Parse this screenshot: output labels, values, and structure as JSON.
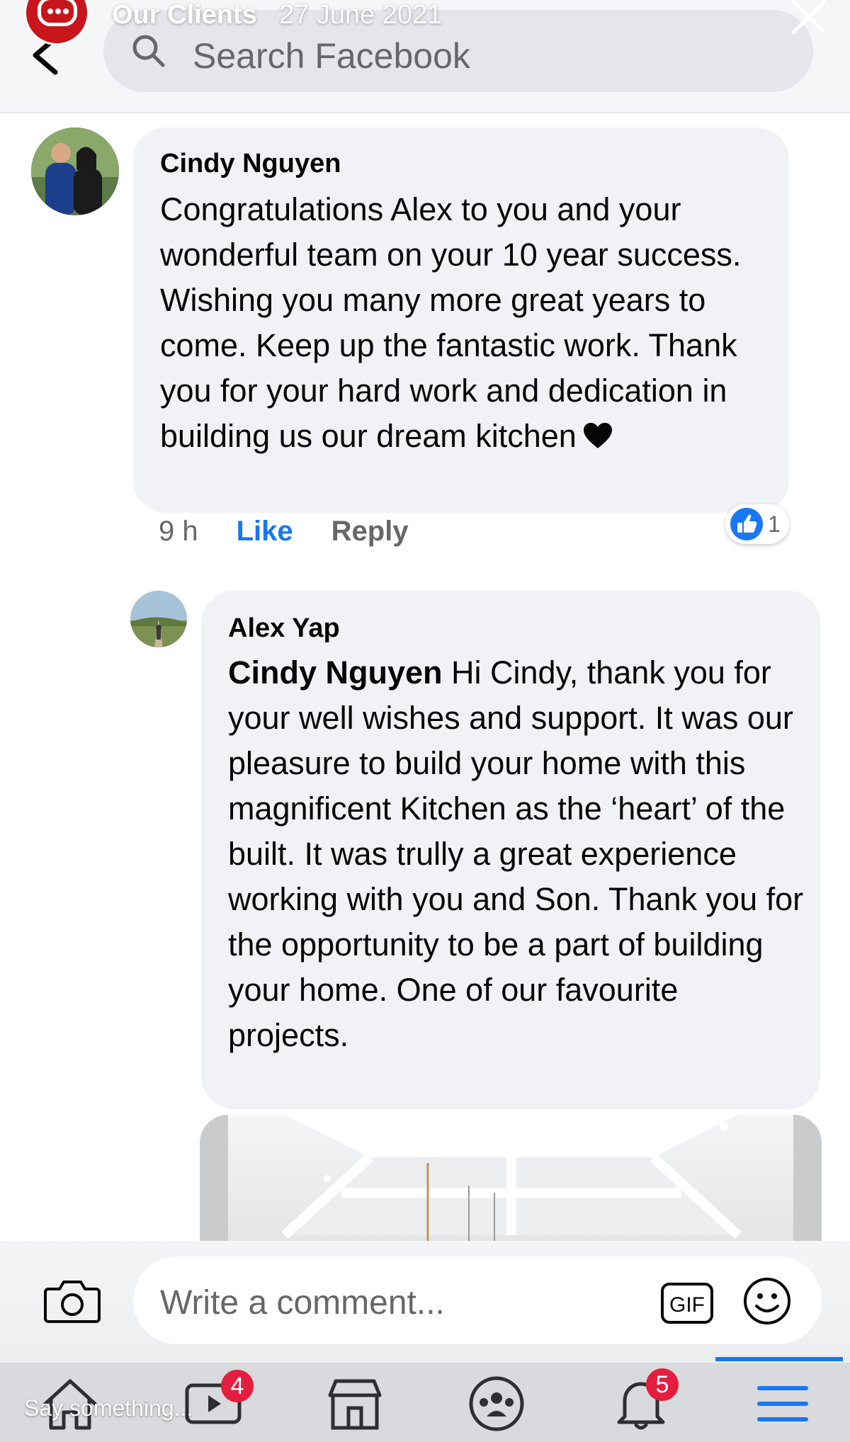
{
  "story": {
    "account_name": "Our Clients",
    "date": "27 June 2021"
  },
  "search": {
    "placeholder": "Search Facebook"
  },
  "comments": [
    {
      "author": "Cindy Nguyen",
      "text": "Congratulations Alex to you and your wonderful team on your 10 year success. Wishing you many more great years to come.  Keep up the fantastic work. Thank you for your hard work and dedication in building us our dream kitchen",
      "time": "9 h",
      "like_label": "Like",
      "reply_label": "Reply",
      "reaction_count": "1"
    },
    {
      "author": "Alex Yap",
      "mention": "Cindy Nguyen",
      "text": " Hi Cindy, thank you for your well wishes and support. It was our pleasure to build your home with this magnificent Kitchen as the ‘heart’ of the built. It was trully a great experience working with you and Son. Thank you for the opportunity to be a part of building your home. One of our favourite projects."
    }
  ],
  "composer": {
    "placeholder": "Write a comment...",
    "gif_label": "GIF"
  },
  "nav": {
    "video_badge": "4",
    "notifications_badge": "5"
  },
  "story_reply": {
    "placeholder": "Say something..."
  },
  "colors": {
    "accent": "#1877f2",
    "badge": "#e41e3f",
    "bubble": "#f0f2f5"
  }
}
